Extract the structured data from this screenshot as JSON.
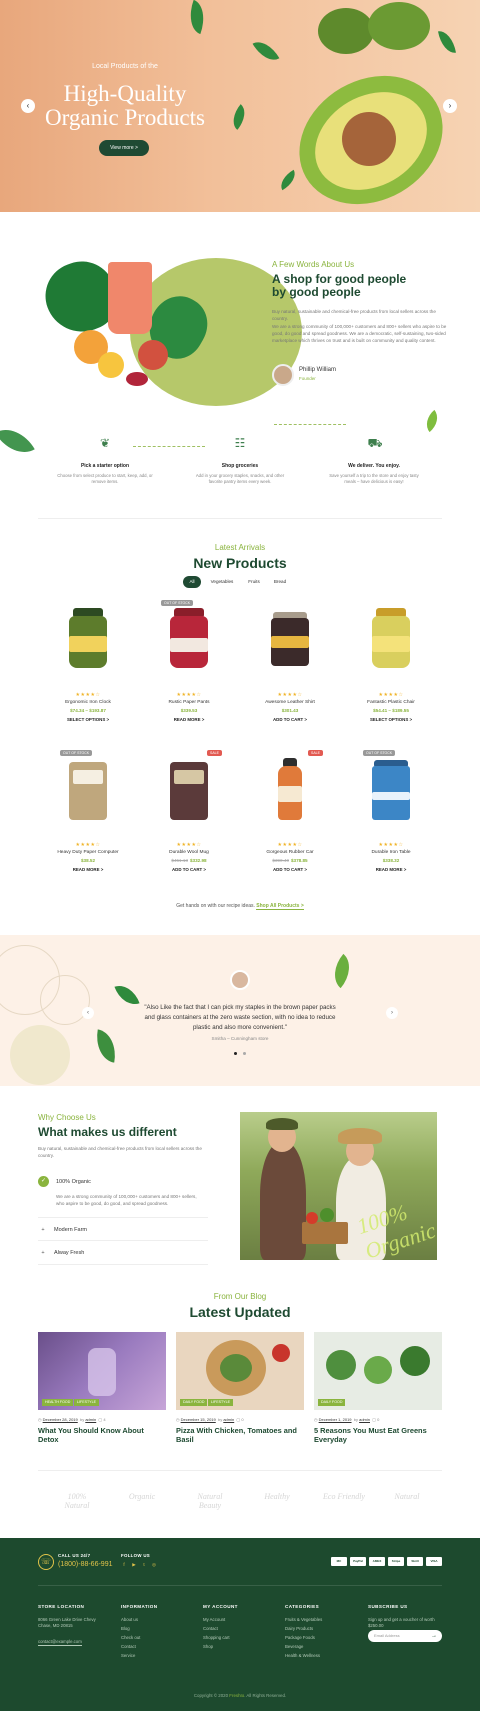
{
  "hero": {
    "subtitle": "Local Products of the",
    "title_line1": "High-Quality",
    "title_line2": "Organic Products",
    "button": "View more >",
    "prev_icon": "chevron-left-icon",
    "next_icon": "chevron-right-icon"
  },
  "about": {
    "kicker": "A Few Words About Us",
    "title_line1": "A shop for good people",
    "title_line2": "by good people",
    "para1": "Buy natural, sustainable and chemical-free products from local sellers across the country.",
    "para2": "We are a strong community of 100,000+ customers and 800+ sellers who aspire to be good, do good and spread goodness. We are a democratic, self-sustaining, two-sided marketplace which thrives on trust and is built on community and quality content.",
    "author": "Phillip William",
    "role": "Founder"
  },
  "steps": [
    {
      "icon": "sprout-icon",
      "title": "Pick a starter option",
      "desc": "Choose from select produce to start, keep, add, or remove items."
    },
    {
      "icon": "basket-icon",
      "title": "Shop groceries",
      "desc": "Add in your grocery staples, snacks, and other favorite pantry items every week."
    },
    {
      "icon": "truck-icon",
      "title": "We deliver. You enjoy.",
      "desc": "Save yourself a trip to the store and enjoy tasty meals – have delicious is easy!"
    }
  ],
  "products_section": {
    "kicker": "Latest Arrivals",
    "title": "New Products",
    "filters": [
      "All",
      "Vegetables",
      "Fruits",
      "Bread"
    ],
    "active_filter": "All",
    "note": "Get hands on with our recipe ideas.",
    "note_link": "Shop All Products >"
  },
  "products": [
    {
      "name": "Ergonomic Iron Clock",
      "price": "$74.34 – $193.87",
      "old_price": "",
      "stars": "★★★★☆",
      "cta": "SELECT OPTIONS >",
      "badge": ""
    },
    {
      "name": "Rustic Paper Pants",
      "price": "$339.53",
      "old_price": "",
      "stars": "★★★★☆",
      "cta": "READ MORE >",
      "badge": "OUT OF STOCK"
    },
    {
      "name": "Awesome Leather Shirt",
      "price": "$301.43",
      "old_price": "",
      "stars": "★★★★☆",
      "cta": "ADD TO CART >",
      "badge": ""
    },
    {
      "name": "Fantastic Plastic Chair",
      "price": "$54.41 – $189.55",
      "old_price": "",
      "stars": "★★★★☆",
      "cta": "SELECT OPTIONS >",
      "badge": ""
    },
    {
      "name": "Heavy Duty Paper Computer",
      "price": "$38.52",
      "old_price": "",
      "stars": "★★★★☆",
      "cta": "READ MORE >",
      "badge": "OUT OF STOCK"
    },
    {
      "name": "Durable Wool Mug",
      "price": "$332.98",
      "old_price": "$451.13",
      "stars": "★★★★☆",
      "cta": "ADD TO CART >",
      "badge": "SALE"
    },
    {
      "name": "Gorgeous Rubber Car",
      "price": "$378.85",
      "old_price": "$390.40",
      "stars": "★★★★☆",
      "cta": "ADD TO CART >",
      "badge": "SALE"
    },
    {
      "name": "Durable Iron Table",
      "price": "$338.32",
      "old_price": "",
      "stars": "★★★★☆",
      "cta": "READ MORE >",
      "badge": "OUT OF STOCK"
    }
  ],
  "testimonial": {
    "quote": "\"Also Like the fact that I can pick my staples in the brown paper packs and glass containers at the zero waste section, with no idea to reduce plastic and also more convenient.\"",
    "who": "Smitha – Cunningham store"
  },
  "why": {
    "kicker": "Why Choose Us",
    "title": "What makes us different",
    "intro": "Buy natural, sustainable and chemical-free products from local sellers across the country.",
    "open_item": "100% Organic",
    "open_text": "We are a strong community of 100,000+ customers and 800+ sellers, who aspire to be good, do good, and spread goodness.",
    "items": [
      "Modern Farm",
      "Alway Fresh"
    ],
    "image_text": "100% Organic"
  },
  "blog": {
    "kicker": "From Our Blog",
    "title": "Latest Updated",
    "posts": [
      {
        "date": "December 28, 2019",
        "author": "admin",
        "comments": "4",
        "tags": [
          "HEALTH FOOD",
          "LIFESTYLE"
        ],
        "title": "What You Should Know About Detox"
      },
      {
        "date": "December 15, 2019",
        "author": "admin",
        "comments": "0",
        "tags": [
          "DAILY FOOD",
          "LIFESTYLE"
        ],
        "title": "Pizza With Chicken, Tomatoes and Basil"
      },
      {
        "date": "December 1, 2019",
        "author": "admin",
        "comments": "0",
        "tags": [
          "DAILY FOOD"
        ],
        "title": "5 Reasons You Must Eat Greens Everyday"
      }
    ]
  },
  "brands": [
    "100% Natural",
    "Organic",
    "Natural Beauty",
    "Healthy",
    "Eco Friendly",
    "Natural"
  ],
  "footer": {
    "call_label": "CALL US 24/7",
    "phone": "(1800)-88-66-991",
    "follow_label": "FOLLOW US",
    "social": [
      "facebook-icon",
      "youtube-icon",
      "twitter-icon",
      "instagram-icon"
    ],
    "payments": [
      "MC",
      "PayPal",
      "AMEX",
      "Stripe",
      "Skrill",
      "VISA"
    ],
    "columns": [
      {
        "title": "STORE LOCATION",
        "items": [
          "8066 Green Lake Drive Chevy Chase, MD 20815",
          "contact@example.com"
        ]
      },
      {
        "title": "INFORMATION",
        "items": [
          "About us",
          "Blog",
          "Check out",
          "Contact",
          "Service"
        ]
      },
      {
        "title": "MY ACCOUNT",
        "items": [
          "My Account",
          "Contact",
          "Shopping cart",
          "Shop"
        ]
      },
      {
        "title": "CATEGORIES",
        "items": [
          "Fruits & Vegetables",
          "Dairy Products",
          "Package Foods",
          "Beverage",
          "Health & Wellness"
        ]
      },
      {
        "title": "SUBSCRIBE US",
        "items": [
          "Sign up and get a voucher of worth $250.00"
        ]
      }
    ],
    "email_placeholder": "Email Address",
    "copyright": "Copyright © 2020",
    "brand_name": "FreshIo",
    "rights": ". All Rights Reserved."
  },
  "colors": {
    "primary": "#1d4a2e",
    "accent": "#8ab43e",
    "hero": "#e8a77c",
    "testimonial_bg": "#fdf1e7"
  }
}
